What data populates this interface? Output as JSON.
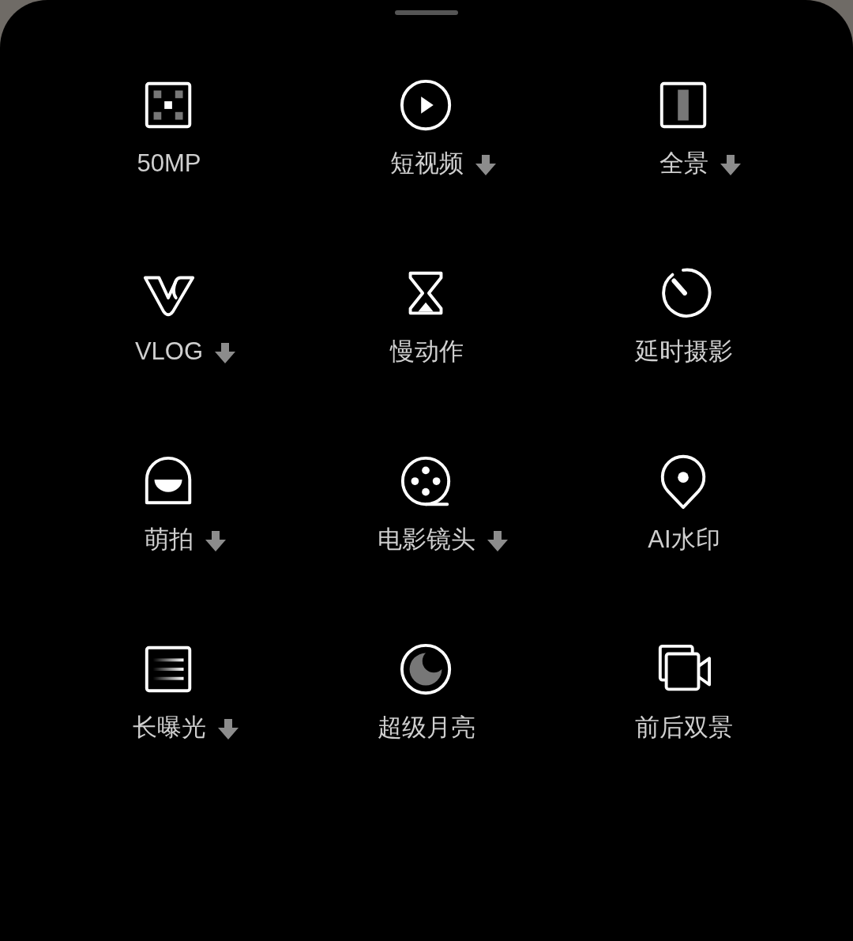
{
  "modes": [
    {
      "label": "50MP",
      "download": false
    },
    {
      "label": "短视频",
      "download": true
    },
    {
      "label": "全景",
      "download": true
    },
    {
      "label": "VLOG",
      "download": true
    },
    {
      "label": "慢动作",
      "download": false
    },
    {
      "label": "延时摄影",
      "download": false
    },
    {
      "label": "萌拍",
      "download": true
    },
    {
      "label": "电影镜头",
      "download": true
    },
    {
      "label": "AI水印",
      "download": false
    },
    {
      "label": "长曝光",
      "download": true
    },
    {
      "label": "超级月亮",
      "download": false
    },
    {
      "label": "前后双景",
      "download": false
    }
  ]
}
